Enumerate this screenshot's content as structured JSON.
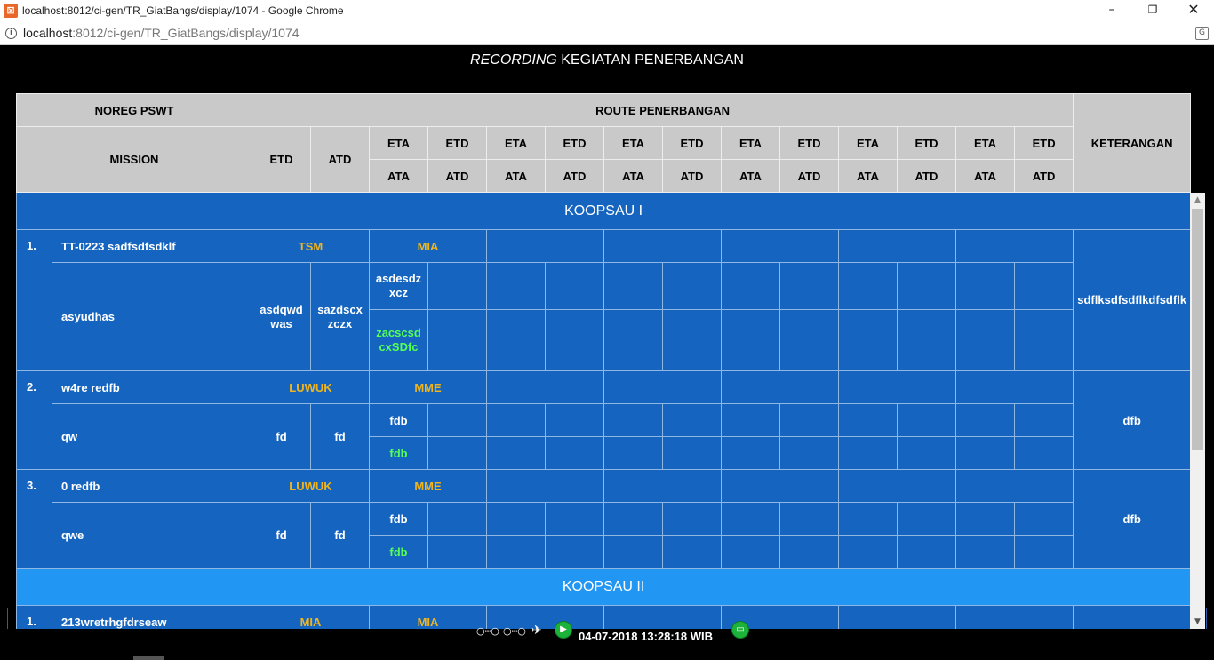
{
  "window": {
    "title": "localhost:8012/ci-gen/TR_GiatBangs/display/1074 - Google Chrome",
    "minimize": "–",
    "maximize": "❐",
    "close": "✕"
  },
  "address": {
    "host": "localhost",
    "path": ":8012/ci-gen/TR_GiatBangs/display/1074"
  },
  "page": {
    "title_italic": "RECORDING",
    "title_rest": " KEGIATAN PENERBANGAN"
  },
  "header": {
    "noreg": "NOREG PSWT",
    "route": "ROUTE PENERBANGAN",
    "mission": "MISSION",
    "etd": "ETD",
    "atd": "ATD",
    "eta": "ETA",
    "ata": "ATA",
    "keterangan": "KETERANGAN"
  },
  "sections": [
    {
      "name": "KOOPSAU I",
      "rows": [
        {
          "no": "1.",
          "noreg": "TT-0223 sadfsdfsdklf",
          "from": "TSM",
          "to": "MIA",
          "mission": "asyudhas",
          "etd": "asdqwdwas",
          "atd": "sazdscxzczx",
          "eta": "asdesdzxcz",
          "ata": "zacscsdcxSDfc",
          "keterangan": "sdflksdfsdflkdfsdflk"
        },
        {
          "no": "2.",
          "noreg": "w4re redfb",
          "from": "LUWUK",
          "to": "MME",
          "mission": "qw",
          "etd": "fd",
          "atd": "fd",
          "eta": "fdb",
          "ata": "fdb",
          "keterangan": "dfb"
        },
        {
          "no": "3.",
          "noreg": "0 redfb",
          "from": "LUWUK",
          "to": "MME",
          "mission": "qwe",
          "etd": "fd",
          "atd": "fd",
          "eta": "fdb",
          "ata": "fdb",
          "keterangan": "dfb"
        }
      ]
    },
    {
      "name": "KOOPSAU II",
      "rows": [
        {
          "no": "1.",
          "noreg": "213wretrhgfdrseaw",
          "from": "MIA",
          "to": "MIA"
        }
      ]
    }
  ],
  "footer": {
    "clock": "04-07-2018 13:28:18 WIB"
  },
  "scrollbar": {
    "up": "▲",
    "down": "▼"
  }
}
